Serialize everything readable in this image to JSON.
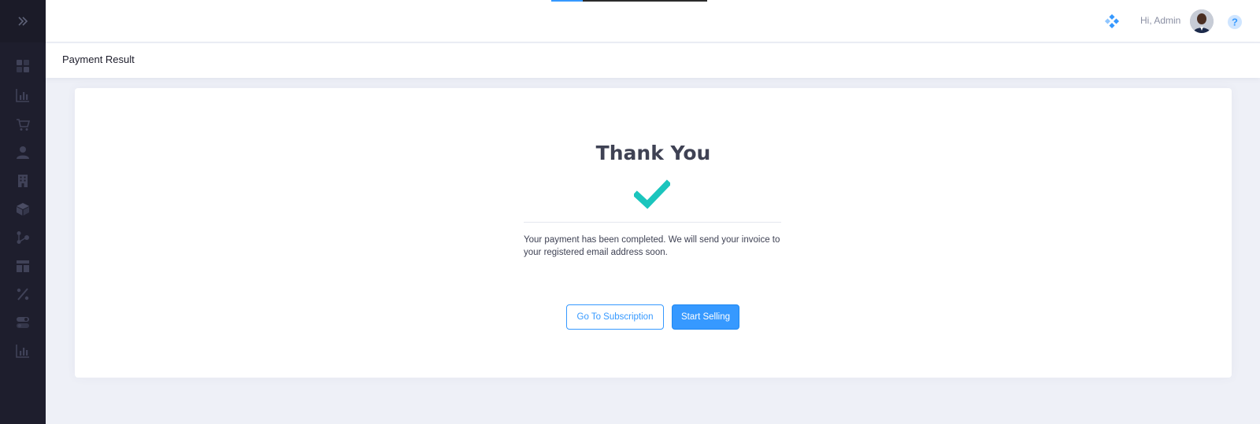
{
  "sidebar": {
    "toggle_icon": "chevron-double-right-icon",
    "items": [
      {
        "name": "dashboard",
        "icon": "grid-icon"
      },
      {
        "name": "reports",
        "icon": "bar-chart-icon"
      },
      {
        "name": "orders",
        "icon": "cart-icon"
      },
      {
        "name": "customers",
        "icon": "user-icon"
      },
      {
        "name": "stores",
        "icon": "building-icon"
      },
      {
        "name": "products",
        "icon": "box-icon"
      },
      {
        "name": "integrations",
        "icon": "nodes-icon"
      },
      {
        "name": "layout",
        "icon": "table-icon"
      },
      {
        "name": "discounts",
        "icon": "percent-icon"
      },
      {
        "name": "settings",
        "icon": "toggle-icon"
      },
      {
        "name": "analytics",
        "icon": "bar-chart-icon"
      }
    ]
  },
  "header": {
    "greeting": "Hi, Admin",
    "apps_icon": "apps-diamond-icon",
    "help_icon": "question-circle-icon"
  },
  "subheader": {
    "title": "Payment Result"
  },
  "result": {
    "title": "Thank You",
    "message": "Your payment has been completed. We will send your invoice to your registered email address soon.",
    "secondary_button": "Go To Subscription",
    "primary_button": "Start Selling"
  },
  "colors": {
    "accent": "#3699ff",
    "success": "#1bc5bd",
    "sidebar_bg": "#1e1e2d",
    "page_bg": "#eef0f7"
  }
}
